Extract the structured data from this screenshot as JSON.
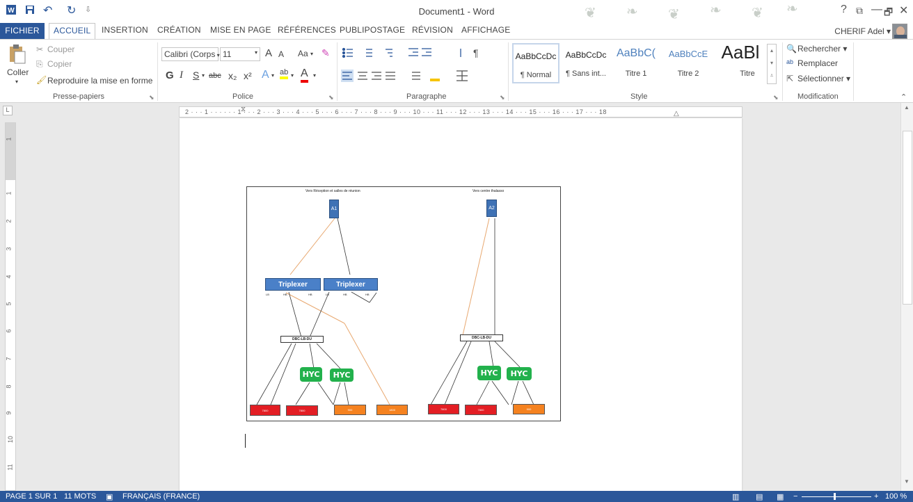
{
  "window": {
    "title": "Document1 - Word",
    "help": "?",
    "restore_ribbon": "⧉",
    "minimize": "—",
    "maximize": "🗗",
    "close": "✕"
  },
  "qat": {
    "word_icon": "word-icon",
    "save_icon": "save-icon",
    "undo": "↶",
    "redo": "↻",
    "customize": "⇩"
  },
  "tabs": [
    {
      "label": "FICHIER"
    },
    {
      "label": "ACCUEIL"
    },
    {
      "label": "INSERTION"
    },
    {
      "label": "CRÉATION"
    },
    {
      "label": "MISE EN PAGE"
    },
    {
      "label": "RÉFÉRENCES"
    },
    {
      "label": "PUBLIPOSTAGE"
    },
    {
      "label": "RÉVISION"
    },
    {
      "label": "AFFICHAGE"
    }
  ],
  "user": {
    "name": "CHERIF Adel ▾"
  },
  "clipboard": {
    "coller": "Coller",
    "couper": "Couper",
    "copier": "Copier",
    "reproduire": "Reproduire la mise en forme",
    "group": "Presse-papiers"
  },
  "font": {
    "family": "Calibri (Corps",
    "size": "11",
    "grow": "A",
    "shrink": "A",
    "case": "Aa",
    "bold": "G",
    "italic": "I",
    "underline": "S",
    "strike": "abc",
    "sub": "x₂",
    "sup": "x²",
    "effects": "A",
    "highlight": "ab",
    "color": "A",
    "group": "Police"
  },
  "paragraph": {
    "group": "Paragraphe"
  },
  "styles": {
    "items": [
      {
        "sample": "AaBbCcDc",
        "name": "¶ Normal"
      },
      {
        "sample": "AaBbCcDc",
        "name": "¶ Sans int..."
      },
      {
        "sample": "AaBbC(",
        "name": "Titre 1"
      },
      {
        "sample": "AaBbCcE",
        "name": "Titre 2"
      },
      {
        "sample": "AaBl",
        "name": "Titre"
      }
    ],
    "group": "Style"
  },
  "editing": {
    "rechercher": "Rechercher ▾",
    "remplacer": "Remplacer",
    "selectionner": "Sélectionner ▾",
    "group": "Modification"
  },
  "ruler": {
    "h": "2 · · · 1 · · ·  · · · 1 · · · 2 · · · 3 · · · 4 · · · 5 · · · 6 · · · 7 · · · 8 · · · 9 · · · 10 · · · 11 · · · 12 · · · 13 · · · 14 · · · 15 · · · 16 · · · 17 · · · 18",
    "corner": "L",
    "v": [
      "1",
      "1",
      "2",
      "3",
      "4",
      "5",
      "6",
      "7",
      "8",
      "9",
      "10",
      "11"
    ]
  },
  "diagram": {
    "left_title": "Vers Réception et salles de réunion",
    "right_title": "Vers centre thalasso",
    "a1": "A1",
    "a2": "A2",
    "triplexer": "Triplexer",
    "dbc": "DBC-LB-DU",
    "hyc": "HYC",
    "port_lb": "LB",
    "port_hb": "HB",
    "box_values": [
      "7800",
      "7800",
      "900",
      "1800",
      "7800",
      "7800",
      "900"
    ]
  },
  "status": {
    "page": "PAGE 1 SUR 1",
    "words": "11 MOTS",
    "language": "FRANÇAIS (FRANCE)",
    "zoom": "100 %"
  },
  "colors": {
    "accent": "#2b579a",
    "blue_node": "#4a80c8",
    "hyc_green": "#22b14c",
    "red_box": "#e31e24",
    "orange_box": "#f58220"
  }
}
